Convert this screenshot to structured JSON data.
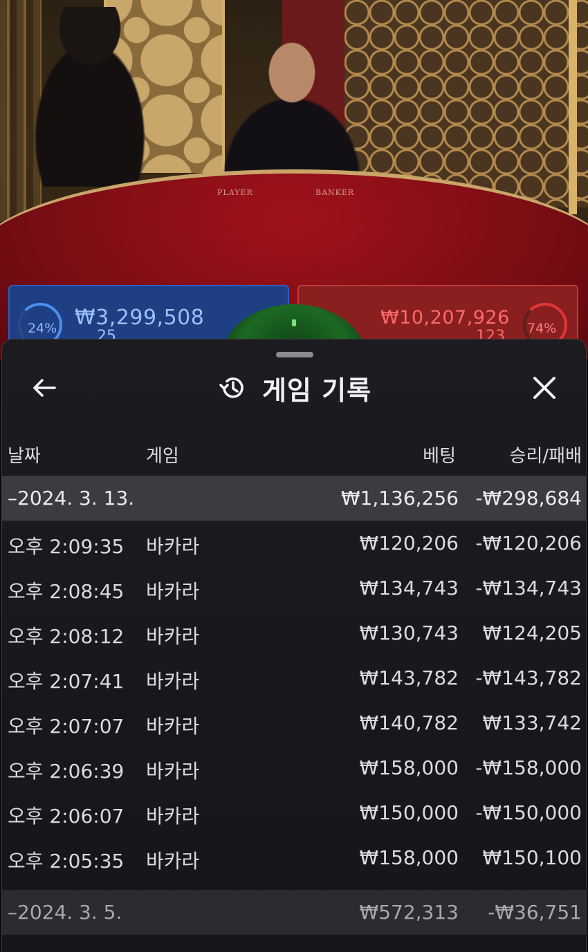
{
  "table": {
    "player_label": "PLAYER",
    "banker_label": "BANKER",
    "player": {
      "percent": "24%",
      "amount": "₩3,299,508",
      "count": "25",
      "color": "#2f5cc4"
    },
    "banker": {
      "percent": "74%",
      "amount": "₩10,207,926",
      "count": "123",
      "color": "#e23636"
    }
  },
  "header": {
    "back_icon": "arrow-left-icon",
    "history_icon": "history-clock-icon",
    "title": "게임 기록",
    "close_icon": "close-icon"
  },
  "columns": {
    "date": "날짜",
    "game": "게임",
    "bet": "베팅",
    "result": "승리/패배"
  },
  "groups": [
    {
      "date": "–2024. 3. 13.",
      "bet": "₩1,136,256",
      "result": "-₩298,684",
      "rows": [
        {
          "time": "오후 2:09:35",
          "game": "바카라",
          "bet": "₩120,206",
          "result": "-₩120,206"
        },
        {
          "time": "오후 2:08:45",
          "game": "바카라",
          "bet": "₩134,743",
          "result": "-₩134,743"
        },
        {
          "time": "오후 2:08:12",
          "game": "바카라",
          "bet": "₩130,743",
          "result": "₩124,205"
        },
        {
          "time": "오후 2:07:41",
          "game": "바카라",
          "bet": "₩143,782",
          "result": "-₩143,782"
        },
        {
          "time": "오후 2:07:07",
          "game": "바카라",
          "bet": "₩140,782",
          "result": "₩133,742"
        },
        {
          "time": "오후 2:06:39",
          "game": "바카라",
          "bet": "₩158,000",
          "result": "-₩158,000"
        },
        {
          "time": "오후 2:06:07",
          "game": "바카라",
          "bet": "₩150,000",
          "result": "-₩150,000"
        },
        {
          "time": "오후 2:05:35",
          "game": "바카라",
          "bet": "₩158,000",
          "result": "₩150,100"
        }
      ]
    },
    {
      "date": "–2024. 3. 5.",
      "bet": "₩572,313",
      "result": "-₩36,751",
      "rows": []
    }
  ]
}
